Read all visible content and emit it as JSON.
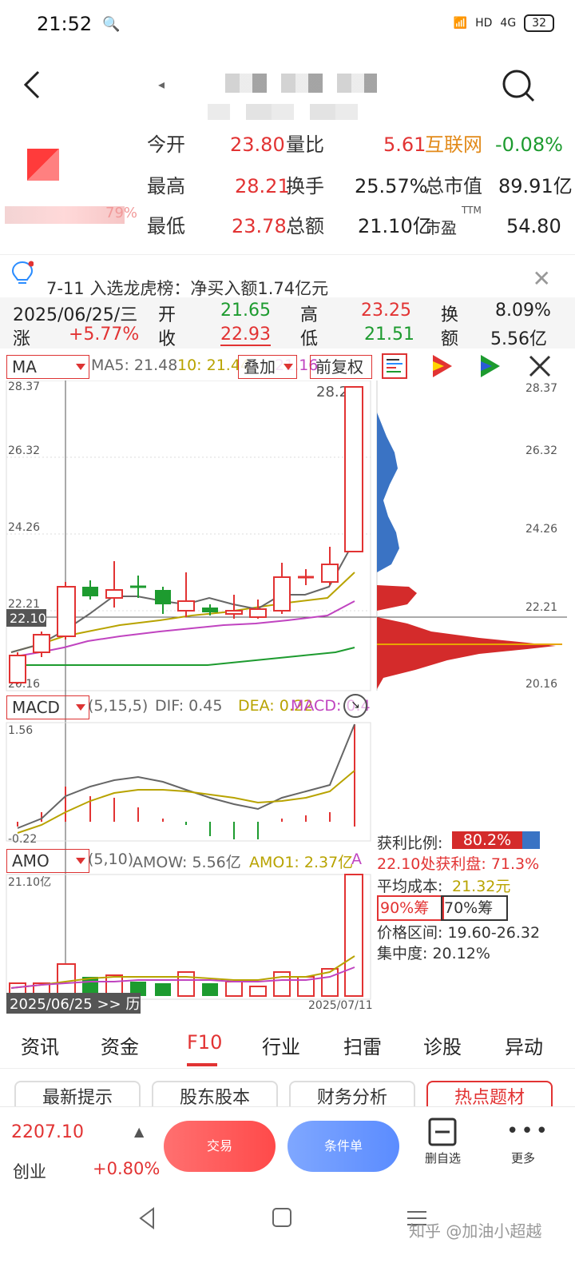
{
  "status_bar": {
    "time": "21:52",
    "indicators": [
      "HD",
      "4G"
    ],
    "battery": "32"
  },
  "stock": {
    "quotes": [
      {
        "label": "今开",
        "value": "23.80"
      },
      {
        "label": "量比",
        "value": "5.61"
      },
      {
        "label": "互联网",
        "value": "-0.08%"
      },
      {
        "label": "最高",
        "value": "28.21"
      },
      {
        "label": "换手",
        "value": "25.57%"
      },
      {
        "label": "总市值",
        "value": "89.91亿"
      },
      {
        "label": "最低",
        "value": "23.78"
      },
      {
        "label": "总额",
        "value": "21.10亿"
      },
      {
        "label": "市盈",
        "value": "54.80"
      }
    ],
    "pct_text": "79%",
    "ttm": "TTM"
  },
  "notice": {
    "text": "7-11 入选龙虎榜：净买入额1.74亿元"
  },
  "day": {
    "date": "2025/06/25/三",
    "open_label": "开",
    "open": "21.65",
    "high_label": "高",
    "high": "23.25",
    "turn_label": "换",
    "turn": "8.09%",
    "change_label": "涨",
    "change": "+5.77%",
    "close_label": "收",
    "close": "22.93",
    "low_label": "低",
    "low": "21.51",
    "amount_label": "额",
    "amount": "5.56亿"
  },
  "toolbar": {
    "indicator": "MA",
    "ma5": "MA5: 21.48",
    "ma10": "10: 21.44",
    "ma20": "21.16",
    "overlay": "叠加",
    "adjust": "前复权"
  },
  "chart": {
    "price_labels": [
      "28.37",
      "26.32",
      "24.26",
      "22.21",
      "20.16"
    ],
    "cursor_price": "22.10",
    "max_label": "28.21",
    "macd_select": "MACD",
    "macd_params": "(5,15,5)",
    "dif": "DIF: 0.45",
    "dea": "DEA: 0.22",
    "macd_val": "MACD: 0.4",
    "macd_top": "1.56",
    "macd_bottom": "-0.22",
    "amo_select": "AMO",
    "amo_params": "(5,10)",
    "amow": "AMOW: 5.56亿",
    "amo1": "AMO1: 2.37亿",
    "amo_suffix": "A",
    "amo_top": "21.10亿",
    "date_left": "2025/06/25 >> 历",
    "date_right": "2025/07/11"
  },
  "chips": {
    "profit_ratio_label": "获利比例:",
    "profit_ratio": "80.2%",
    "profit_at": "22.10处获利盘: 71.3%",
    "avg_cost_label": "平均成本:",
    "avg_cost": "21.32元",
    "btn90": "90%筹",
    "btn70": "70%筹",
    "range": "价格区间: 19.60-26.32",
    "concentration": "集中度: 20.12%"
  },
  "tabs": [
    "资讯",
    "资金",
    "F10",
    "行业",
    "扫雷",
    "诊股",
    "异动"
  ],
  "pills": [
    "最新提示",
    "股东股本",
    "财务分析",
    "热点题材"
  ],
  "bottom": {
    "index_value": "2207.10",
    "index_name": "创业",
    "index_change": "+0.80%",
    "trade": "交易",
    "condition": "条件单",
    "remove": "删自选",
    "more": "更多"
  },
  "watermark": "知乎 @加油小超越",
  "colors": {
    "red": "#e23333",
    "green": "#1d9b2f",
    "blue": "#3a73c4"
  }
}
